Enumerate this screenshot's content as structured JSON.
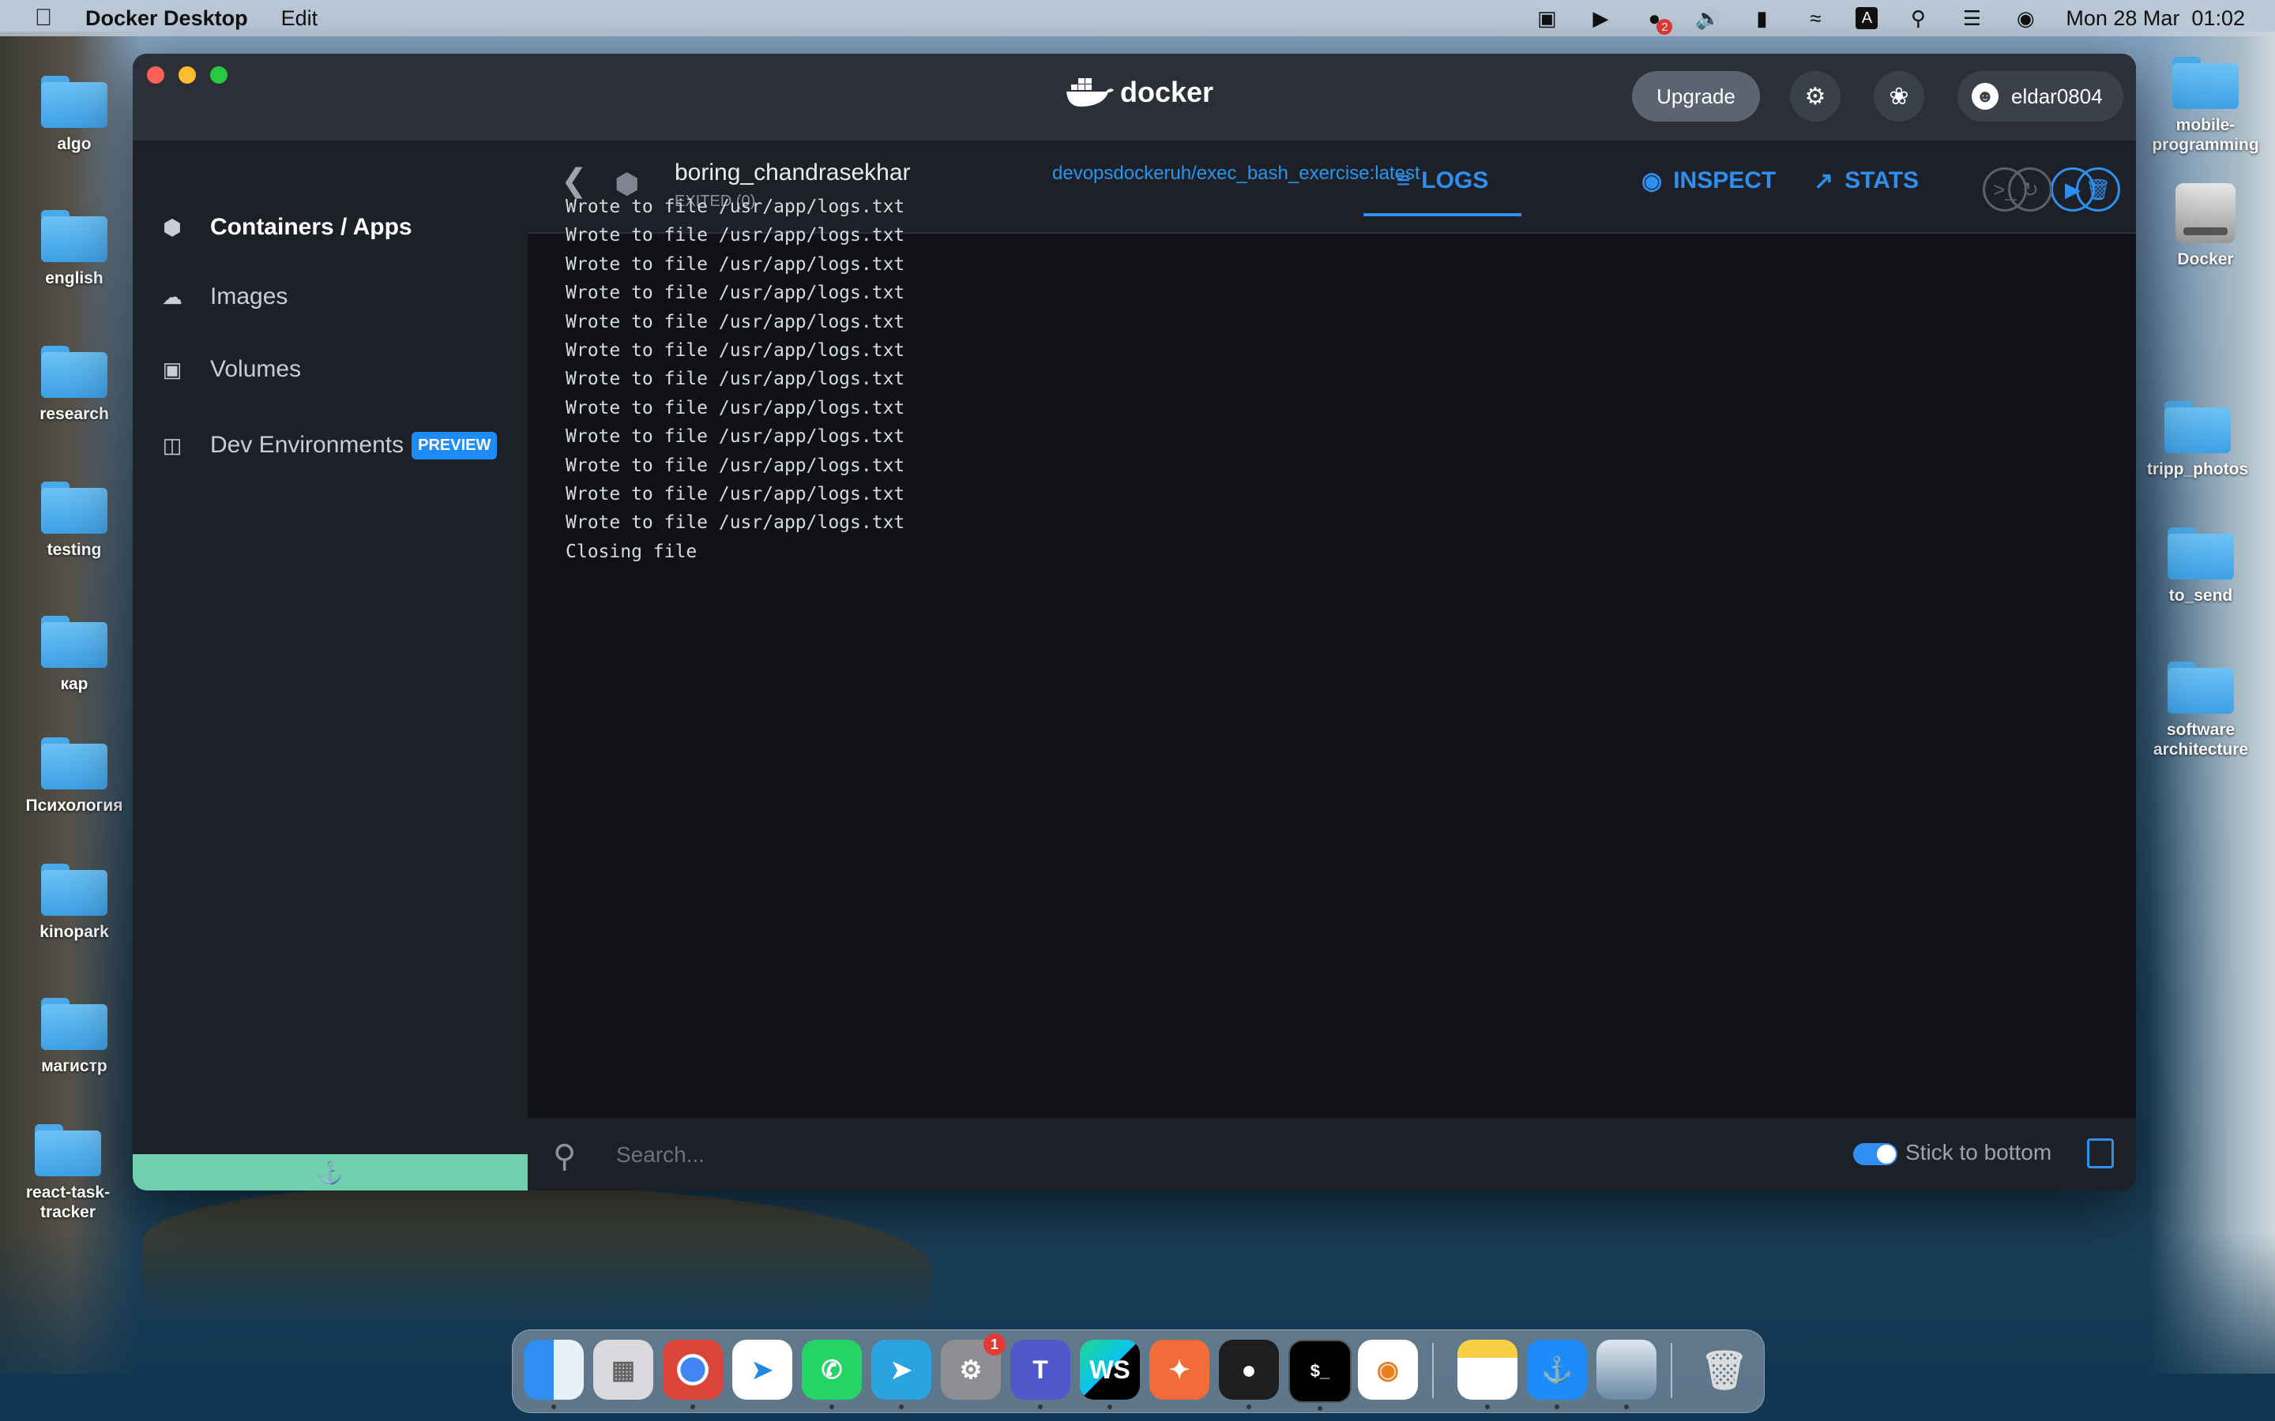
{
  "menubar": {
    "app_name": "Docker Desktop",
    "menu_edit": "Edit",
    "notification_count": "2",
    "datetime": "Mon 28 Mar  01:02"
  },
  "desktop_left": [
    {
      "label": "algo"
    },
    {
      "label": "english"
    },
    {
      "label": "research"
    },
    {
      "label": "testing"
    },
    {
      "label": "кар"
    },
    {
      "label": "Психология"
    },
    {
      "label": "kinopark"
    },
    {
      "label": "магистр"
    },
    {
      "label": "react-task-tracker"
    }
  ],
  "desktop_right": [
    {
      "label": "mobile-programming"
    },
    {
      "label": "Docker"
    },
    {
      "label": "tripp_photos"
    },
    {
      "label": "to_send"
    },
    {
      "label": "software architecture"
    }
  ],
  "window": {
    "logo_text": "docker",
    "upgrade_label": "Upgrade",
    "username": "eldar0804"
  },
  "sidebar": {
    "items": [
      {
        "label": "Containers / Apps",
        "icon": "container-icon"
      },
      {
        "label": "Images",
        "icon": "cloud-icon"
      },
      {
        "label": "Volumes",
        "icon": "disk-icon"
      },
      {
        "label": "Dev Environments",
        "icon": "layers-icon",
        "badge": "PREVIEW"
      }
    ]
  },
  "container": {
    "name": "boring_chandrasekhar",
    "image": "devopsdockeruh/exec_bash_exercise:latest",
    "status": "EXITED (0)"
  },
  "tabs": {
    "logs": "LOGS",
    "inspect": "INSPECT",
    "stats": "STATS"
  },
  "logs": [
    "Wrote to file /usr/app/logs.txt",
    "Wrote to file /usr/app/logs.txt",
    "Wrote to file /usr/app/logs.txt",
    "Wrote to file /usr/app/logs.txt",
    "Wrote to file /usr/app/logs.txt",
    "Wrote to file /usr/app/logs.txt",
    "Wrote to file /usr/app/logs.txt",
    "Wrote to file /usr/app/logs.txt",
    "Wrote to file /usr/app/logs.txt",
    "Wrote to file /usr/app/logs.txt",
    "Wrote to file /usr/app/logs.txt",
    "Wrote to file /usr/app/logs.txt",
    "Closing file"
  ],
  "search": {
    "placeholder": "Search...",
    "stick_label": "Stick to bottom",
    "stick_enabled": true
  },
  "dock": {
    "settings_badge": "1",
    "webstorm_label": "WS",
    "terminal_label": "$_"
  },
  "colors": {
    "accent": "#2e8ff0",
    "preview_badge": "#1d8cf8",
    "footer": "#6fcfae"
  }
}
